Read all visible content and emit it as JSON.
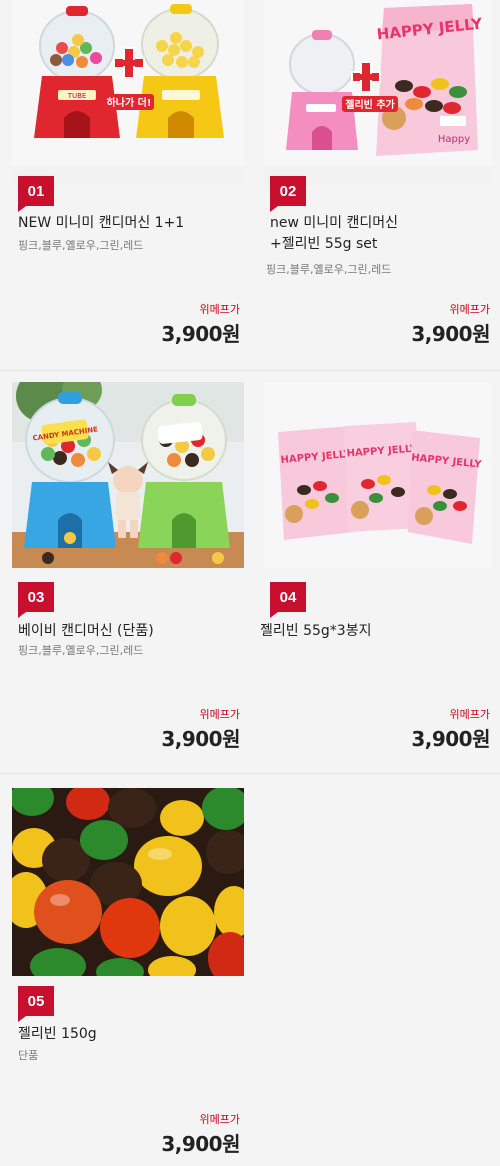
{
  "products": [
    {
      "rank": "01",
      "name_line1": "NEW 미니미 캔디머신 1+1",
      "name_line2": "",
      "options": "핑크,블루,옐로우,그린,레드",
      "store": "위메프가",
      "price": "3,900원",
      "image_caption": "하나가 더!",
      "machine_label": "TUBE"
    },
    {
      "rank": "02",
      "name_line1": "new 미니미 캔디머신",
      "name_line2": "+젤리빈 55g set",
      "options": "핑크,블루,옐로우,그린,레드",
      "store": "위메프가",
      "price": "3,900원",
      "image_caption": "젤리빈 추가",
      "bag_title": "HAPPY JELLY",
      "bag_footer": "Happy"
    },
    {
      "rank": "03",
      "name_line1": "베이비 캔디머신 (단품)",
      "name_line2": "",
      "options": "핑크,블루,옐로우,그린,레드",
      "store": "위메프가",
      "price": "3,900원",
      "machine_label": "CANDY MACHINE"
    },
    {
      "rank": "04",
      "name_line1": "젤리빈 55g*3봉지",
      "name_line2": "",
      "options": "",
      "store": "위메프가",
      "price": "3,900원",
      "bag_title": "HAPPY JELLY"
    },
    {
      "rank": "05",
      "name_line1": "젤리빈 150g",
      "name_line2": "",
      "options": "단품",
      "store": "위메프가",
      "price": "3,900원"
    }
  ],
  "colors": {
    "accent": "#c8102e",
    "price_store": "#d0021b",
    "background": "#f4f4f4"
  }
}
